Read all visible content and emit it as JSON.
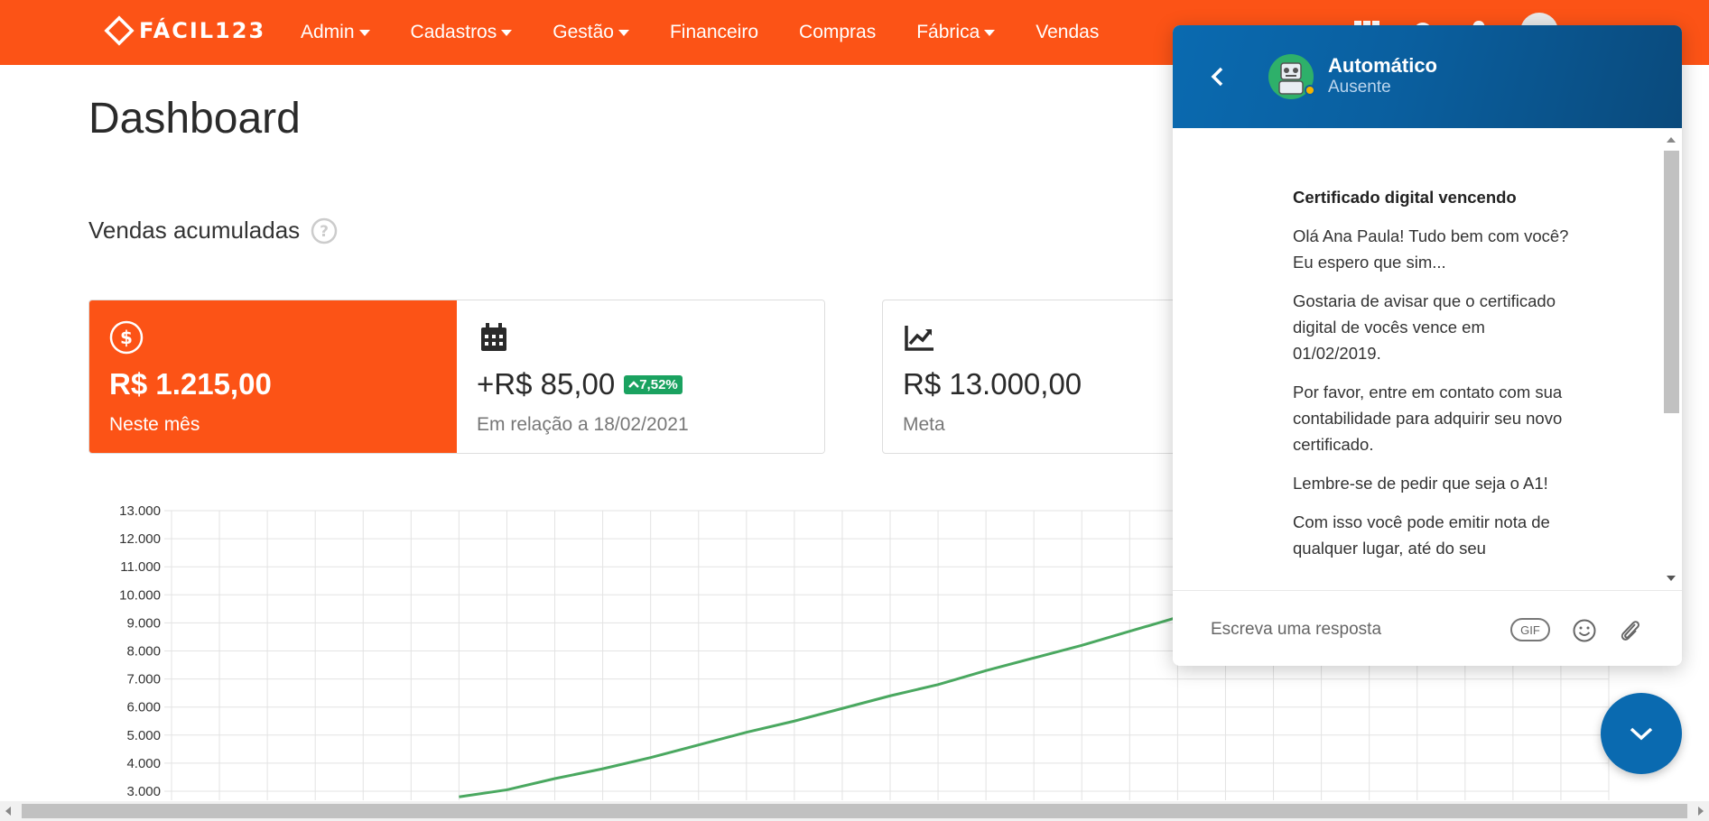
{
  "navbar": {
    "brand": "FÁCIL123",
    "items": [
      {
        "label": "Admin",
        "dropdown": true
      },
      {
        "label": "Cadastros",
        "dropdown": true
      },
      {
        "label": "Gestão",
        "dropdown": true
      },
      {
        "label": "Financeiro",
        "dropdown": false
      },
      {
        "label": "Compras",
        "dropdown": false
      },
      {
        "label": "Fábrica",
        "dropdown": true
      },
      {
        "label": "Vendas",
        "dropdown": false
      }
    ],
    "right_icons": [
      "apps-grid-icon",
      "gear-icon",
      "bell-icon",
      "user-avatar-icon"
    ],
    "color": "#fc5316"
  },
  "page": {
    "title": "Dashboard",
    "section_title": "Vendas acumuladas"
  },
  "cards": {
    "month": {
      "icon": "dollar-circle-icon",
      "value": "R$ 1.215,00",
      "label": "Neste mês"
    },
    "comparison": {
      "icon": "calendar-icon",
      "value": "+R$ 85,00",
      "badge": "7,52%",
      "badge_icon": "chevron-up-icon",
      "label": "Em relação a 18/02/2021"
    },
    "goal": {
      "icon": "trend-chart-icon",
      "value": "R$ 13.000,00",
      "label": "Meta"
    }
  },
  "chart_data": {
    "type": "line",
    "title": "",
    "xlabel": "",
    "ylabel": "",
    "y_ticks": [
      "13.000",
      "12.000",
      "11.000",
      "10.000",
      "9.000",
      "8.000",
      "7.000",
      "6.000",
      "5.000",
      "4.000",
      "3.000"
    ],
    "ylim": [
      3000,
      13000
    ],
    "grid": true,
    "series": [
      {
        "color": "#4aa860",
        "x": [
          6.0,
          7.0,
          8.0,
          9.0,
          10.0,
          11.0,
          12.0,
          13.0,
          14.0,
          15.0,
          16.0,
          17.0,
          18.0,
          19.0,
          20.0,
          21.0
        ],
        "y": [
          2800,
          3050,
          3450,
          3800,
          4200,
          4650,
          5100,
          5500,
          5950,
          6400,
          6800,
          7300,
          7750,
          8200,
          8700,
          9200
        ]
      }
    ],
    "x_columns": 30
  },
  "chat": {
    "agent_name": "Automático",
    "agent_status": "Ausente",
    "message": {
      "title": "Certificado digital vencendo",
      "paragraphs": [
        "Olá Ana Paula! Tudo bem com você? Eu espero que sim...",
        "Gostaria de avisar que o certificado digital de vocês vence em 01/02/2019.",
        "Por favor, entre em contato com sua contabilidade para adquirir seu novo certificado.",
        "Lembre-se de pedir que seja o A1!",
        "Com isso você pode emitir nota de qualquer lugar, até do seu"
      ]
    },
    "reply_placeholder": "Escreva uma resposta",
    "gif_label": "GIF",
    "header_color": "#0a6ab0"
  }
}
